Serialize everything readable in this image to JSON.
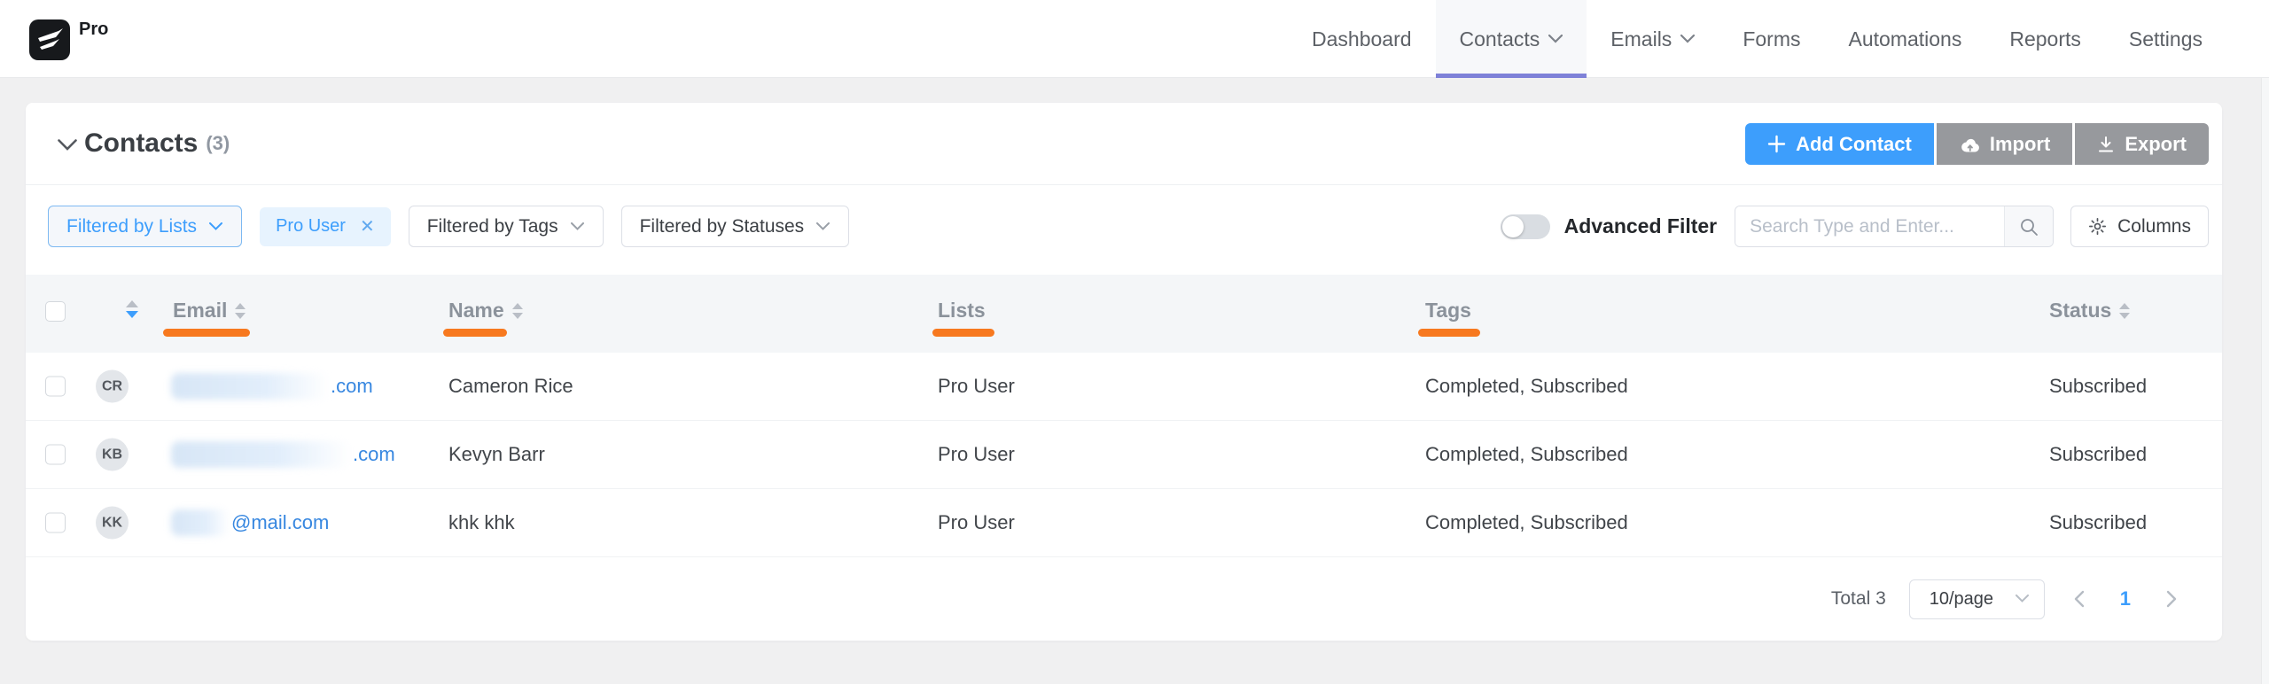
{
  "brand": {
    "badge": "Pro"
  },
  "nav": {
    "items": [
      {
        "label": "Dashboard"
      },
      {
        "label": "Contacts"
      },
      {
        "label": "Emails"
      },
      {
        "label": "Forms"
      },
      {
        "label": "Automations"
      },
      {
        "label": "Reports"
      },
      {
        "label": "Settings"
      }
    ]
  },
  "header": {
    "title": "Contacts",
    "count": "(3)",
    "add_button": "Add Contact",
    "import_button": "Import",
    "export_button": "Export"
  },
  "filters": {
    "lists_dropdown": "Filtered by Lists",
    "active_tag": "Pro User",
    "tags_dropdown": "Filtered by Tags",
    "statuses_dropdown": "Filtered by Statuses",
    "advanced_filter_label": "Advanced Filter",
    "search_placeholder": "Search Type and Enter...",
    "columns_button": "Columns"
  },
  "table": {
    "columns": {
      "email": "Email",
      "name": "Name",
      "lists": "Lists",
      "tags": "Tags",
      "status": "Status"
    },
    "rows": [
      {
        "initials": "CR",
        "email_redacted": true,
        "email_visible": ".com",
        "name": "Cameron Rice",
        "lists": "Pro User",
        "tags": "Completed, Subscribed",
        "status": "Subscribed"
      },
      {
        "initials": "KB",
        "email_redacted": true,
        "email_visible": ".com",
        "name": "Kevyn Barr",
        "lists": "Pro User",
        "tags": "Completed, Subscribed",
        "status": "Subscribed"
      },
      {
        "initials": "KK",
        "email_redacted": true,
        "email_visible": "@mail.com",
        "name": "khk khk",
        "lists": "Pro User",
        "tags": "Completed, Subscribed",
        "status": "Subscribed"
      }
    ]
  },
  "pagination": {
    "total": "Total 3",
    "page_size": "10/page",
    "current_page": "1"
  },
  "colors": {
    "primary_blue": "#3d9efc",
    "link_blue": "#3787e0",
    "annotation_orange": "#f7791f",
    "active_tab_underline": "#7e81d8",
    "gray_button": "#97999d",
    "tag_background": "#e7f3fe"
  }
}
